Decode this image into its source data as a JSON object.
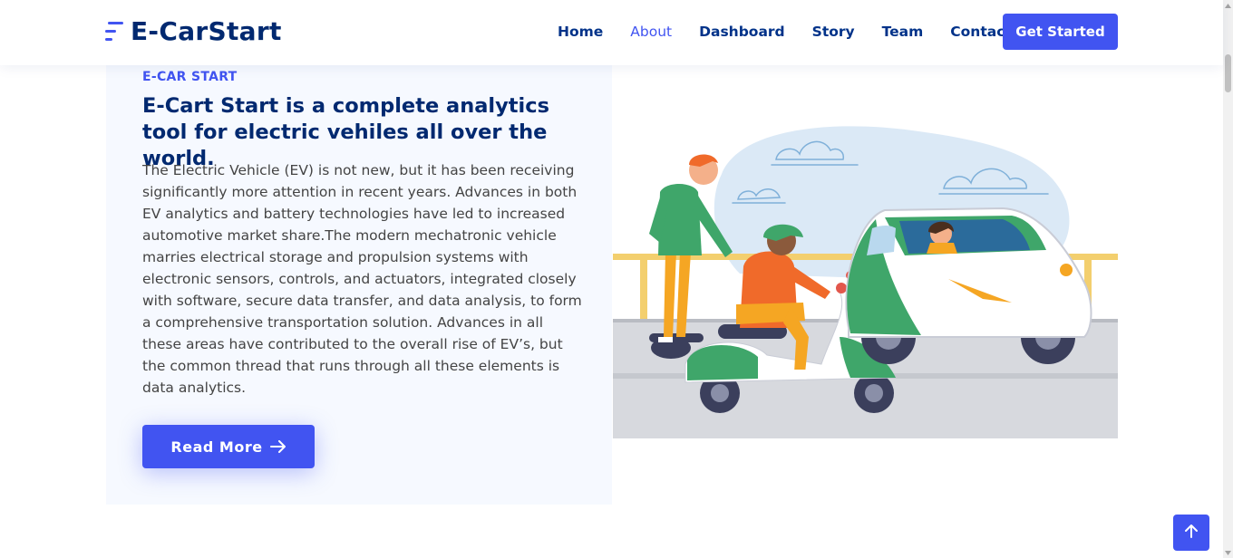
{
  "header": {
    "logo_text": "E-CarStart",
    "nav": [
      {
        "label": "Home"
      },
      {
        "label": "About",
        "active": true
      },
      {
        "label": "Dashboard"
      },
      {
        "label": "Story"
      },
      {
        "label": "Team"
      },
      {
        "label": "Contact"
      }
    ],
    "cta_label": "Get Started"
  },
  "about": {
    "eyebrow": "E-CAR START",
    "headline": "E-Cart Start is a complete analytics tool for electric vehiles all over the world.",
    "body": "The Electric Vehicle (EV) is not new, but it has been receiving significantly more attention in recent years. Advances in both EV analytics and battery technologies have led to increased automotive market share.The modern mechatronic vehicle marries electrical storage and propulsion systems with electronic sensors, controls, and actuators, integrated closely with software, secure data transfer, and data analysis, to form a comprehensive transportation solution. Advances in all these areas have contributed to the overall rise of EV’s, but the common thread that runs through all these elements is data analytics.",
    "read_more_label": "Read More",
    "read_more_icon": "arrow-right-icon"
  },
  "colors": {
    "accent": "#4154f1",
    "heading": "#012970",
    "card_bg": "#f6f9ff"
  },
  "icons": {
    "back_to_top": "arrow-up-icon",
    "logo": "menu-lines-icon"
  }
}
